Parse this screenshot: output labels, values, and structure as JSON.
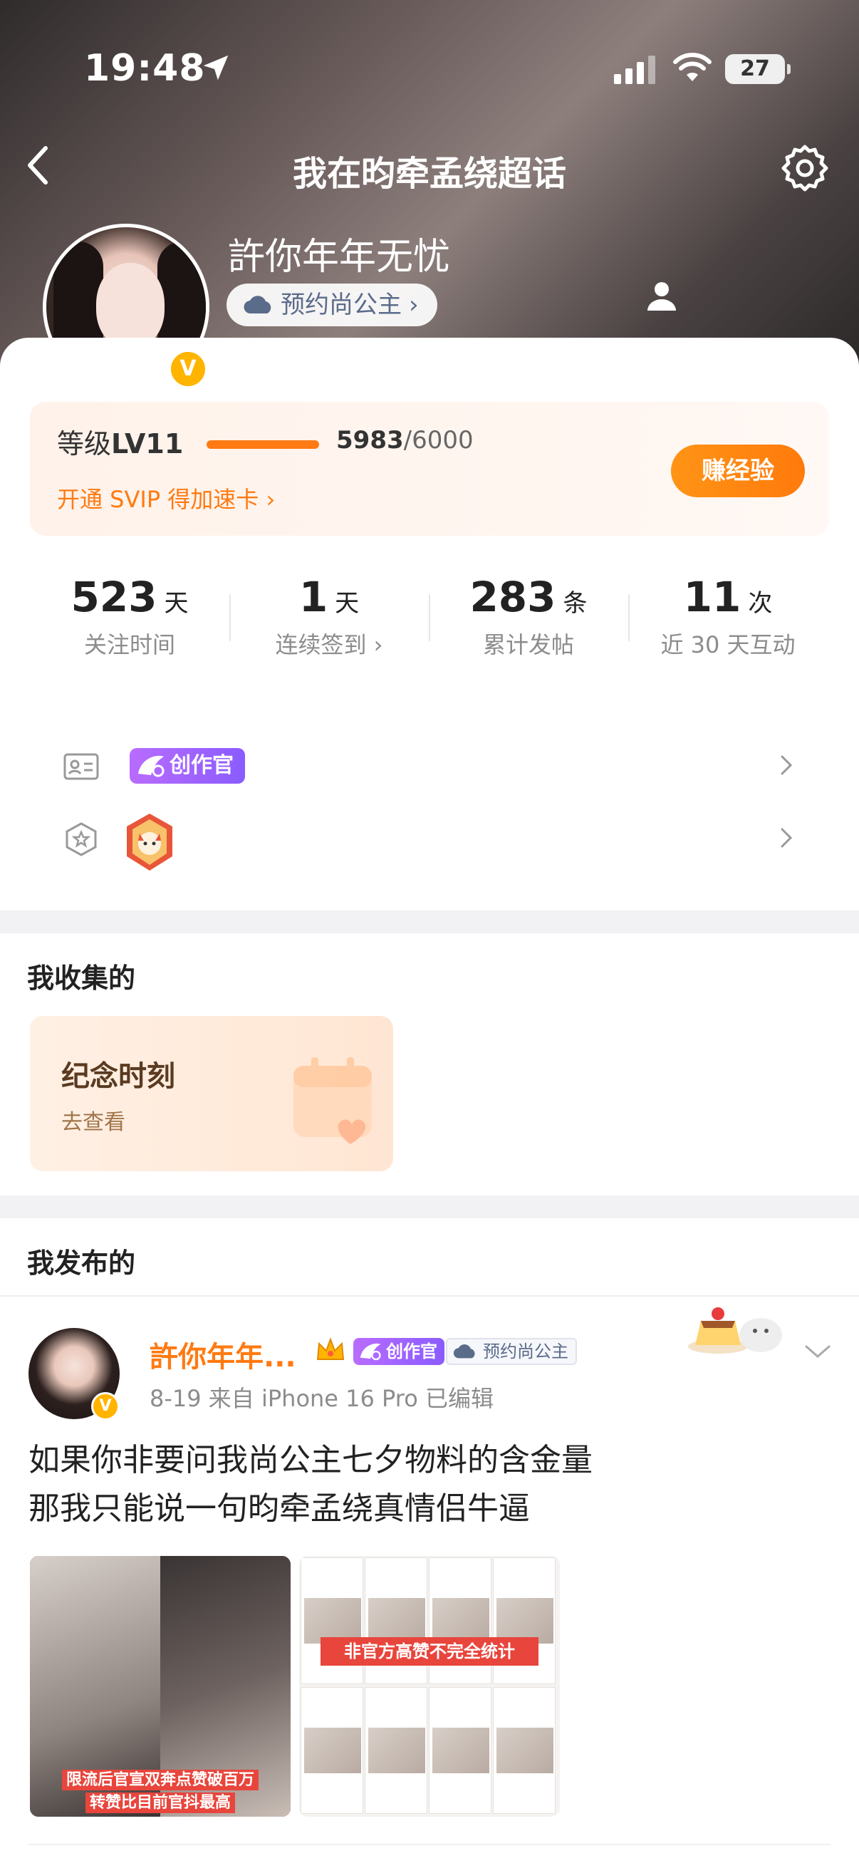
{
  "status_bar": {
    "time": "19:48",
    "battery": "27"
  },
  "header": {
    "title": "我在昀牵孟绕超话"
  },
  "profile": {
    "username": "許你年年无忧",
    "tag": "预约尚公主",
    "tag_arrow": "›",
    "verified": "V"
  },
  "level": {
    "label_prefix": "等级",
    "level": "LV11",
    "progress_current": "5983",
    "progress_total": "/6000",
    "progress_fraction": 0.997,
    "svip_link": "开通 SVIP 得加速卡 ›",
    "earn_button": "赚经验"
  },
  "stats": [
    {
      "value": "523",
      "unit": "天",
      "label": "关注时间"
    },
    {
      "value": "1",
      "unit": "天",
      "label": "连续签到 ›"
    },
    {
      "value": "283",
      "unit": "条",
      "label": "累计发帖"
    },
    {
      "value": "11",
      "unit": "次",
      "label": "近 30 天互动"
    }
  ],
  "badges": {
    "creator_label": "创作官"
  },
  "collected": {
    "title": "我收集的",
    "card_title": "纪念时刻",
    "card_sub": "去查看"
  },
  "posted": {
    "title": "我发布的",
    "post": {
      "author": "許你年年...",
      "creator_label": "创作官",
      "tag": "预约尚公主",
      "meta": "8-19  来自 iPhone 16 Pro  已编辑",
      "body_line1": "如果你非要问我尚公主七夕物料的含金量",
      "body_line2": "那我只能说一句昀牵孟绕真情侣牛逼",
      "image1_caption1": "限流后官宣双奔点赞破百万",
      "image1_caption2": "转赞比目前官抖最高",
      "image2_banner": "非官方高赞不完全统计"
    }
  },
  "colors": {
    "accent": "#ff7a12",
    "creator": "#8a5cff",
    "verified": "#ffb400"
  }
}
